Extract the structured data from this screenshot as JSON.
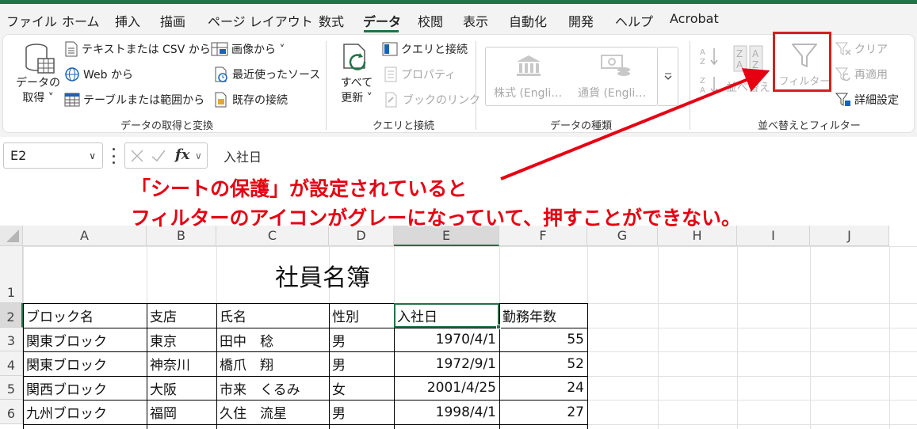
{
  "menu": {
    "items": [
      "ファイル",
      "ホーム",
      "挿入",
      "描画",
      "ページ レイアウト",
      "数式",
      "データ",
      "校閲",
      "表示",
      "自動化",
      "開発",
      "ヘルプ",
      "Acrobat"
    ],
    "active": "データ"
  },
  "ribbon": {
    "get_data": {
      "big_label_1": "データの",
      "big_label_2": "取得 ˅",
      "text_csv": "テキストまたは CSV から",
      "web": "Web から",
      "table_range": "テーブルまたは範囲から",
      "from_picture": "画像から ˅",
      "recent_sources": "最近使ったソース",
      "existing_conn": "既存の接続",
      "group_label": "データの取得と変換"
    },
    "queries": {
      "refresh_all_1": "すべて",
      "refresh_all_2": "更新 ˅",
      "queries_conn": "クエリと接続",
      "properties": "プロパティ",
      "edit_links": "ブックのリンク",
      "group_label": "クエリと接続"
    },
    "data_types": {
      "stocks": "株式 (Engli…",
      "currencies": "通貨 (Engli…",
      "group_label": "データの種類"
    },
    "sort_filter": {
      "sort": "並べ替え",
      "filter": "フィルター",
      "clear": "クリア",
      "reapply": "再適用",
      "advanced": "詳細設定",
      "group_label": "並べ替えとフィルター"
    }
  },
  "formula_bar": {
    "name_box": "E2",
    "fx": "fx",
    "content": "入社日"
  },
  "grid": {
    "columns": [
      "A",
      "B",
      "C",
      "D",
      "E",
      "F",
      "G",
      "H",
      "I",
      "J"
    ],
    "rows": [
      "1",
      "2",
      "3",
      "4",
      "5",
      "6"
    ],
    "title": "社員名簿",
    "headers": [
      "ブロック名",
      "支店",
      "氏名",
      "性別",
      "入社日",
      "勤務年数"
    ],
    "data": [
      [
        "関東ブロック",
        "東京",
        "田中　稔",
        "男",
        "1970/4/1",
        "55"
      ],
      [
        "関東ブロック",
        "神奈川",
        "橋爪　翔",
        "男",
        "1972/9/1",
        "52"
      ],
      [
        "関西ブロック",
        "大阪",
        "市来　くるみ",
        "女",
        "2001/4/25",
        "24"
      ],
      [
        "九州ブロック",
        "福岡",
        "久住　流星",
        "男",
        "1998/4/1",
        "27"
      ]
    ]
  },
  "annotation": {
    "line1": "「シートの保護」が設定されていると",
    "line2": "フィルターのアイコンがグレーになっていて、押すことができない。"
  },
  "colors": {
    "accent": "#217346",
    "annotation": "#e60012",
    "highlight": "#d41f1f"
  }
}
